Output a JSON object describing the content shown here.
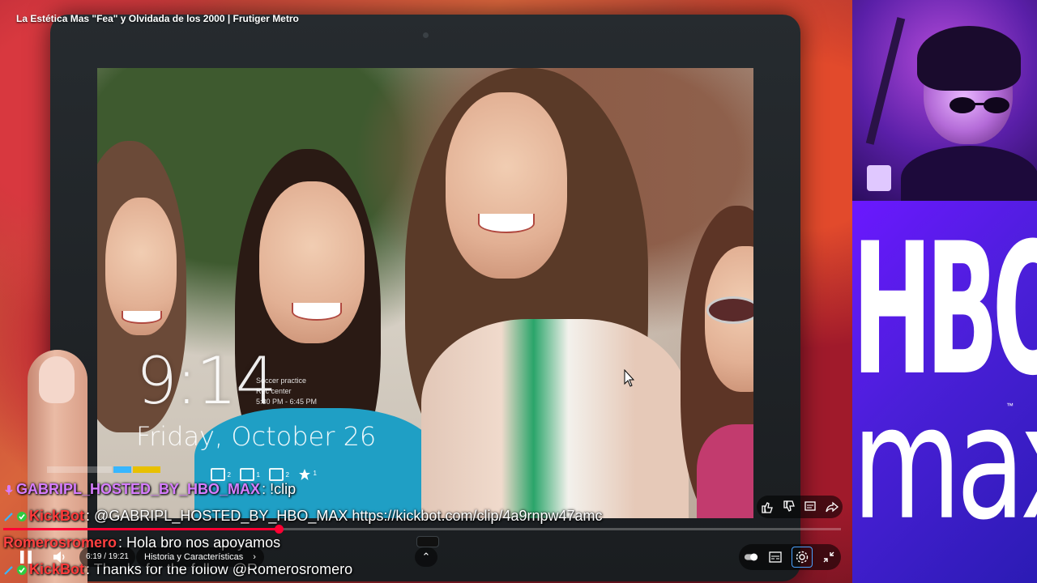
{
  "video": {
    "title": "La Estética Mas \"Fea\" y Olvidada de los 2000 | Frutiger Metro"
  },
  "lockscreen": {
    "time": "9:14",
    "date": "Friday, October 26",
    "event_lines": [
      "Soccer practice",
      "Rec center",
      "5:30 PM - 6:45 PM"
    ],
    "badges": [
      {
        "icon": "mail-icon",
        "count": "2"
      },
      {
        "icon": "message-icon",
        "count": "1"
      },
      {
        "icon": "chat-icon",
        "count": "2"
      },
      {
        "icon": "star-icon",
        "count": "1"
      }
    ]
  },
  "chat": [
    {
      "user": "GABRIPL_HOSTED_BY_HBO_MAX",
      "message": ": !clip",
      "badge": "mic-icon"
    },
    {
      "user": "KickBot",
      "message": ": @GABRIPL_HOSTED_BY_HBO_MAX https://kickbot.com/clip/4a9rnpw47amc",
      "badge": "bot-icon"
    },
    {
      "user": "Romerosromero",
      "message": ": Hola bro nos apoyamos",
      "badge": ""
    },
    {
      "user": "KickBot",
      "message": ": Thanks for the follow @Romerosromero",
      "badge": "bot-icon"
    }
  ],
  "player": {
    "current_time": "6:19 / 19:21",
    "progress": 0.329,
    "chapter": "Historia y Características",
    "colors": {
      "progress": "#ff0033",
      "accent": "#4aa3ff"
    }
  },
  "sidebar": {
    "brand_top": "HBO",
    "brand_bottom": "max",
    "brand_tm": "™"
  }
}
